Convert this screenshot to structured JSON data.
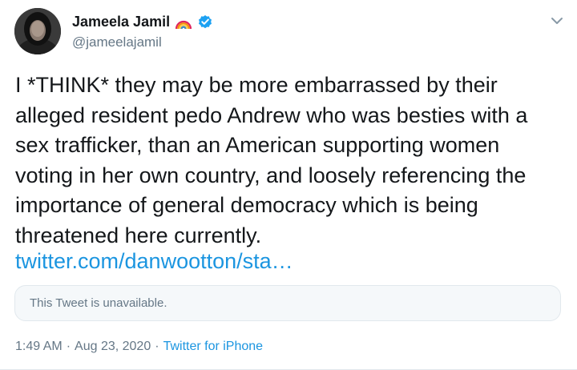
{
  "author": {
    "display_name": "Jameela Jamil",
    "handle": "@jameelajamil",
    "emoji_icon": "rainbow-icon",
    "verified_icon": "verified-badge-icon"
  },
  "tweet": {
    "text": "I *THINK* they may be more embarrassed by their\nalleged resident pedo Andrew who was besties with a\nsex trafficker, than an American supporting women\nvoting in her own country, and loosely referencing the\nimportance of general democracy which is being\nthreatened here currently.",
    "link_text": "twitter.com/danwootton/sta…",
    "quoted_unavailable": "This Tweet is unavailable."
  },
  "meta": {
    "time": "1:49 AM",
    "separator_1": "·",
    "date": "Aug 23, 2020",
    "separator_2": "·",
    "source": "Twitter for iPhone"
  },
  "colors": {
    "link": "#1b95e0",
    "verified": "#1da1f2",
    "secondary_text": "#657786",
    "primary_text": "#14171a",
    "card_bg": "#f5f8fa",
    "card_border": "#e1e8ed"
  },
  "icons": {
    "menu": "chevron-down-icon"
  }
}
